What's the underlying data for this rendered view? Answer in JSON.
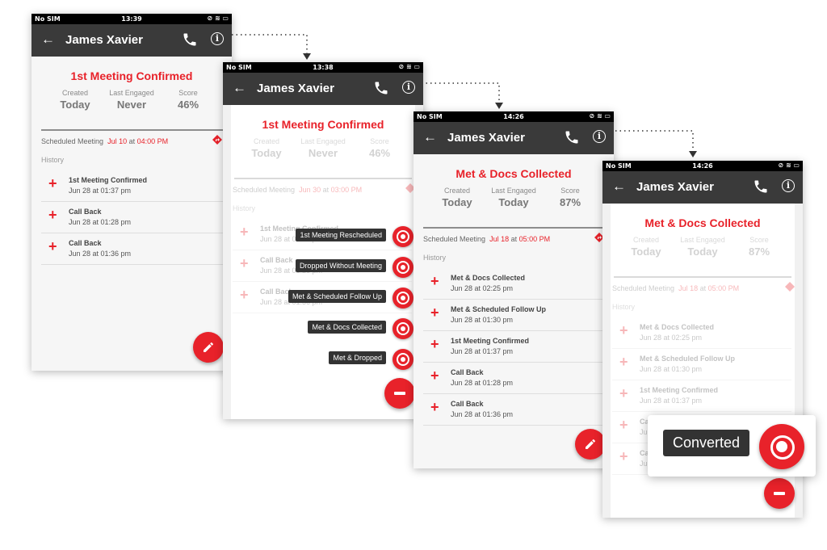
{
  "colors": {
    "accent": "#e8222a",
    "appbar": "#3a3a3a",
    "statusbar": "#000000"
  },
  "icons": [
    "back-arrow-icon",
    "phone-icon",
    "info-icon",
    "plus-icon",
    "route-icon",
    "edit-icon",
    "minus-icon",
    "target-icon",
    "signal-icon",
    "wifi-icon",
    "battery-icon",
    "mute-icon"
  ],
  "screens": [
    {
      "status": {
        "carrier": "No SIM",
        "time": "13:39"
      },
      "contact_name": "James Xavier",
      "title": "1st Meeting Confirmed",
      "stats": [
        {
          "label": "Created",
          "value": "Today"
        },
        {
          "label": "Last Engaged",
          "value": "Never"
        },
        {
          "label": "Score",
          "value": "46%"
        }
      ],
      "scheduled": {
        "label": "Scheduled Meeting",
        "date": "Jul 10",
        "at": "at",
        "time": "04:00 PM"
      },
      "history_label": "History",
      "history": [
        {
          "title": "1st Meeting Confirmed",
          "date": "Jun 28 at 01:37 pm"
        },
        {
          "title": "Call Back",
          "date": "Jun 28 at 01:28 pm"
        },
        {
          "title": "Call Back",
          "date": "Jun 28 at 01:36 pm"
        }
      ]
    },
    {
      "status": {
        "carrier": "No SIM",
        "time": "13:38"
      },
      "contact_name": "James Xavier",
      "title": "1st Meeting Confirmed",
      "stats": [
        {
          "label": "Created",
          "value": "Today"
        },
        {
          "label": "Last Engaged",
          "value": "Never"
        },
        {
          "label": "Score",
          "value": "46%"
        }
      ],
      "scheduled": {
        "label": "Scheduled Meeting",
        "date": "Jun 30",
        "at": "at",
        "time": "03:00 PM"
      },
      "history_label": "History",
      "history": [
        {
          "title": "1st Meeting Confirmed",
          "date": "Jun 28 at 01:37 pm"
        },
        {
          "title": "Call Back",
          "date": "Jun 28 at 01:28 pm"
        },
        {
          "title": "Call Back",
          "date": "Jun 28 at 01:36 pm"
        }
      ],
      "menu": [
        "1st Meeting Rescheduled",
        "Dropped Without Meeting",
        "Met & Scheduled Follow Up",
        "Met & Docs Collected",
        "Met & Dropped"
      ]
    },
    {
      "status": {
        "carrier": "No SIM",
        "time": "14:26"
      },
      "contact_name": "James Xavier",
      "title": "Met & Docs Collected",
      "stats": [
        {
          "label": "Created",
          "value": "Today"
        },
        {
          "label": "Last Engaged",
          "value": "Today"
        },
        {
          "label": "Score",
          "value": "87%"
        }
      ],
      "scheduled": {
        "label": "Scheduled Meeting",
        "date": "Jul 18",
        "at": "at",
        "time": "05:00 PM"
      },
      "history_label": "History",
      "history": [
        {
          "title": "Met & Docs Collected",
          "date": "Jun 28 at 02:25 pm"
        },
        {
          "title": "Met & Scheduled Follow Up",
          "date": "Jun 28 at 01:30 pm"
        },
        {
          "title": "1st Meeting Confirmed",
          "date": "Jun 28 at 01:37 pm"
        },
        {
          "title": "Call Back",
          "date": "Jun 28 at 01:28 pm"
        },
        {
          "title": "Call Back",
          "date": "Jun 28 at 01:36 pm"
        }
      ]
    },
    {
      "status": {
        "carrier": "No SIM",
        "time": "14:26"
      },
      "contact_name": "James Xavier",
      "title": "Met & Docs Collected",
      "stats": [
        {
          "label": "Created",
          "value": "Today"
        },
        {
          "label": "Last Engaged",
          "value": "Today"
        },
        {
          "label": "Score",
          "value": "87%"
        }
      ],
      "scheduled": {
        "label": "Scheduled Meeting",
        "date": "Jul 18",
        "at": "at",
        "time": "05:00 PM"
      },
      "history_label": "History",
      "history": [
        {
          "title": "Met & Docs Collected",
          "date": "Jun 28 at 02:25 pm"
        },
        {
          "title": "Met & Scheduled Follow Up",
          "date": "Jun 28 at 01:30 pm"
        },
        {
          "title": "1st Meeting Confirmed",
          "date": "Jun 28 at 01:37 pm"
        },
        {
          "title": "Ca",
          "date": "Ju"
        },
        {
          "title": "Ca",
          "date": "Ju"
        }
      ],
      "menu_action": "Converted"
    }
  ]
}
